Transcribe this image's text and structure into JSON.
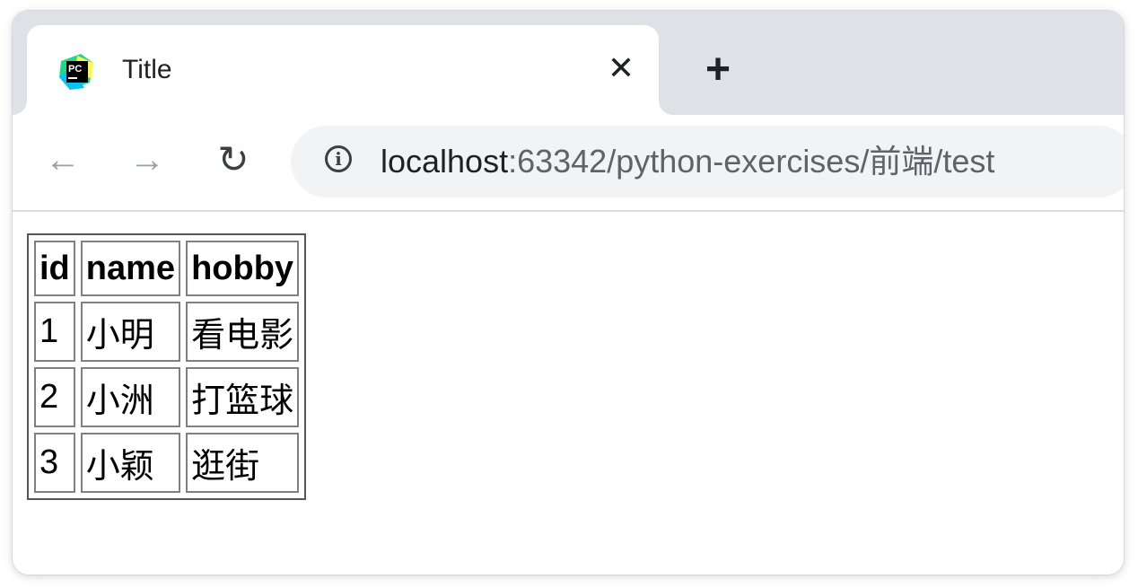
{
  "tab": {
    "title": "Title",
    "favicon": "pycharm-icon",
    "close_glyph": "✕"
  },
  "new_tab_glyph": "+",
  "toolbar": {
    "back_glyph": "←",
    "forward_glyph": "→",
    "reload_glyph": "↻",
    "info_glyph": "i",
    "url_host": "localhost",
    "url_rest": ":63342/python-exercises/前端/test"
  },
  "table": {
    "headers": [
      "id",
      "name",
      "hobby"
    ],
    "rows": [
      [
        "1",
        "小明",
        "看电影"
      ],
      [
        "2",
        "小洲",
        "打篮球"
      ],
      [
        "3",
        "小颖",
        "逛街"
      ]
    ]
  }
}
